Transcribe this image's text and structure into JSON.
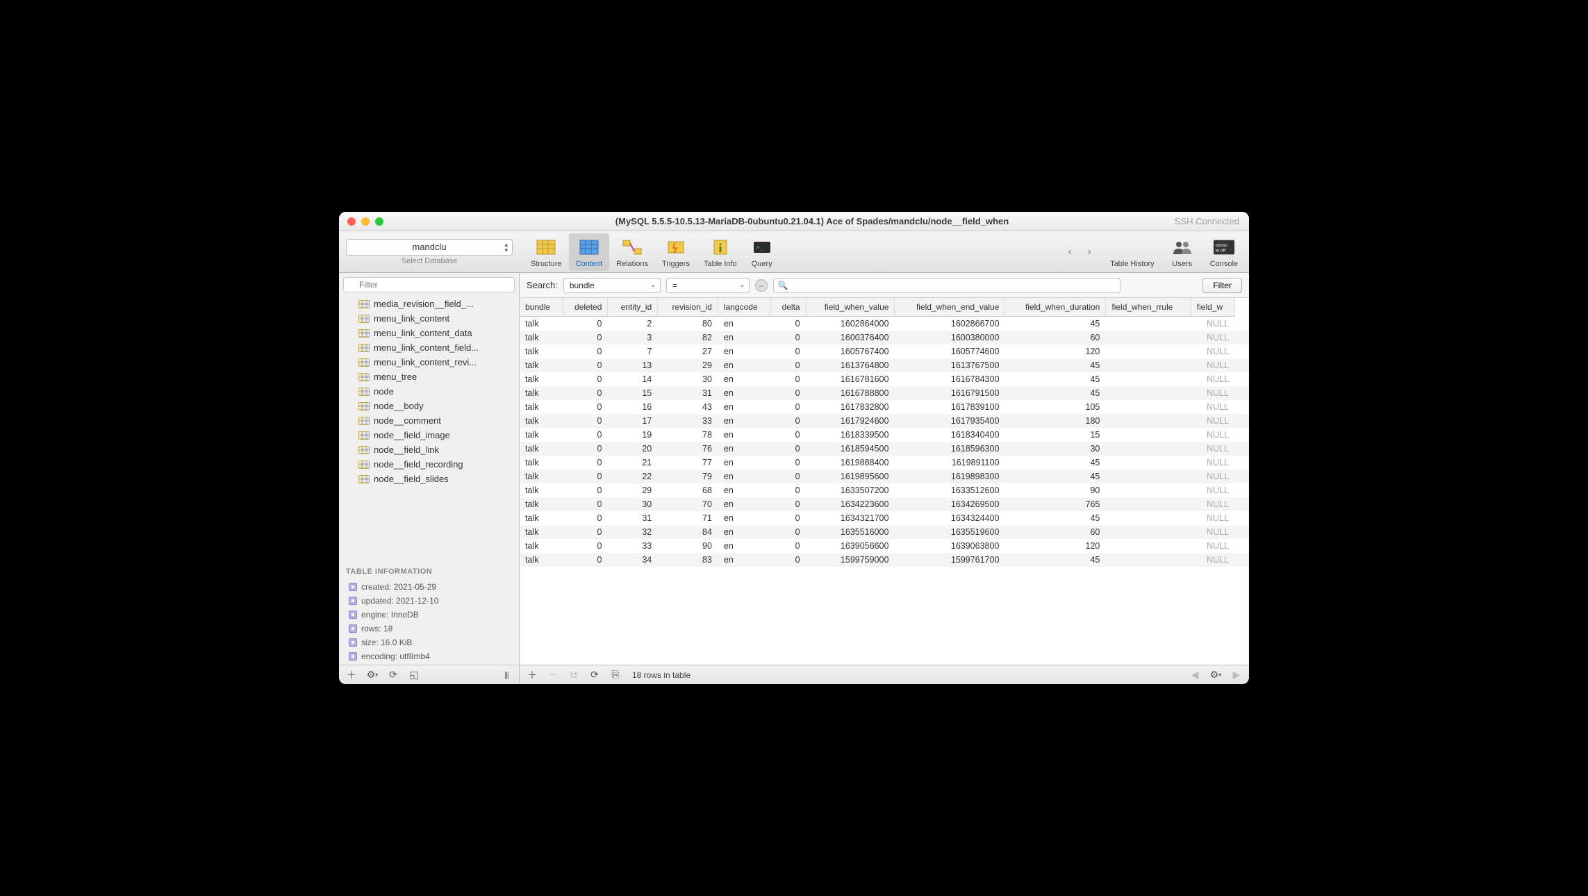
{
  "titlebar": {
    "title": "(MySQL 5.5.5-10.5.13-MariaDB-0ubuntu0.21.04.1) Ace of Spades/mandclu/node__field_when",
    "ssh_status": "SSH Connected"
  },
  "toolbar": {
    "db_selected": "mandclu",
    "db_sub": "Select Database",
    "items": [
      {
        "label": "Structure",
        "name": "structure"
      },
      {
        "label": "Content",
        "name": "content",
        "active": true
      },
      {
        "label": "Relations",
        "name": "relations"
      },
      {
        "label": "Triggers",
        "name": "triggers"
      },
      {
        "label": "Table Info",
        "name": "table-info"
      },
      {
        "label": "Query",
        "name": "query"
      }
    ],
    "right": [
      {
        "label": "Table History",
        "name": "table-history"
      },
      {
        "label": "Users",
        "name": "users"
      },
      {
        "label": "Console",
        "name": "console"
      }
    ]
  },
  "sidebar": {
    "filter_placeholder": "Filter",
    "tables": [
      "media_revision__field_...",
      "menu_link_content",
      "menu_link_content_data",
      "menu_link_content_field...",
      "menu_link_content_revi...",
      "menu_tree",
      "node",
      "node__body",
      "node__comment",
      "node__field_image",
      "node__field_link",
      "node__field_recording",
      "node__field_slides"
    ],
    "info_header": "TABLE INFORMATION",
    "info": [
      "created: 2021-05-29",
      "updated: 2021-12-10",
      "engine: InnoDB",
      "rows: 18",
      "size: 16.0 KiB",
      "encoding: utf8mb4"
    ]
  },
  "search": {
    "label": "Search:",
    "column": "bundle",
    "operator": "=",
    "filter_btn": "Filter"
  },
  "table": {
    "columns": [
      "bundle",
      "deleted",
      "entity_id",
      "revision_id",
      "langcode",
      "delta",
      "field_when_value",
      "field_when_end_value",
      "field_when_duration",
      "field_when_rrule",
      "field_w"
    ],
    "rows": [
      [
        "talk",
        0,
        2,
        80,
        "en",
        0,
        1602864000,
        1602866700,
        45,
        null
      ],
      [
        "talk",
        0,
        3,
        82,
        "en",
        0,
        1600376400,
        1600380000,
        60,
        null
      ],
      [
        "talk",
        0,
        7,
        27,
        "en",
        0,
        1605767400,
        1605774600,
        120,
        null
      ],
      [
        "talk",
        0,
        13,
        29,
        "en",
        0,
        1613764800,
        1613767500,
        45,
        null
      ],
      [
        "talk",
        0,
        14,
        30,
        "en",
        0,
        1616781600,
        1616784300,
        45,
        null
      ],
      [
        "talk",
        0,
        15,
        31,
        "en",
        0,
        1616788800,
        1616791500,
        45,
        null
      ],
      [
        "talk",
        0,
        16,
        43,
        "en",
        0,
        1617832800,
        1617839100,
        105,
        null
      ],
      [
        "talk",
        0,
        17,
        33,
        "en",
        0,
        1617924600,
        1617935400,
        180,
        null
      ],
      [
        "talk",
        0,
        19,
        78,
        "en",
        0,
        1618339500,
        1618340400,
        15,
        null
      ],
      [
        "talk",
        0,
        20,
        76,
        "en",
        0,
        1618594500,
        1618596300,
        30,
        null
      ],
      [
        "talk",
        0,
        21,
        77,
        "en",
        0,
        1619888400,
        1619891100,
        45,
        null
      ],
      [
        "talk",
        0,
        22,
        79,
        "en",
        0,
        1619895600,
        1619898300,
        45,
        null
      ],
      [
        "talk",
        0,
        29,
        68,
        "en",
        0,
        1633507200,
        1633512600,
        90,
        null
      ],
      [
        "talk",
        0,
        30,
        70,
        "en",
        0,
        1634223600,
        1634269500,
        765,
        null
      ],
      [
        "talk",
        0,
        31,
        71,
        "en",
        0,
        1634321700,
        1634324400,
        45,
        null
      ],
      [
        "talk",
        0,
        32,
        84,
        "en",
        0,
        1635516000,
        1635519600,
        60,
        null
      ],
      [
        "talk",
        0,
        33,
        90,
        "en",
        0,
        1639056600,
        1639063800,
        120,
        null
      ],
      [
        "talk",
        0,
        34,
        83,
        "en",
        0,
        1599759000,
        1599761700,
        45,
        null
      ]
    ]
  },
  "status": {
    "row_count": "18 rows in table"
  }
}
